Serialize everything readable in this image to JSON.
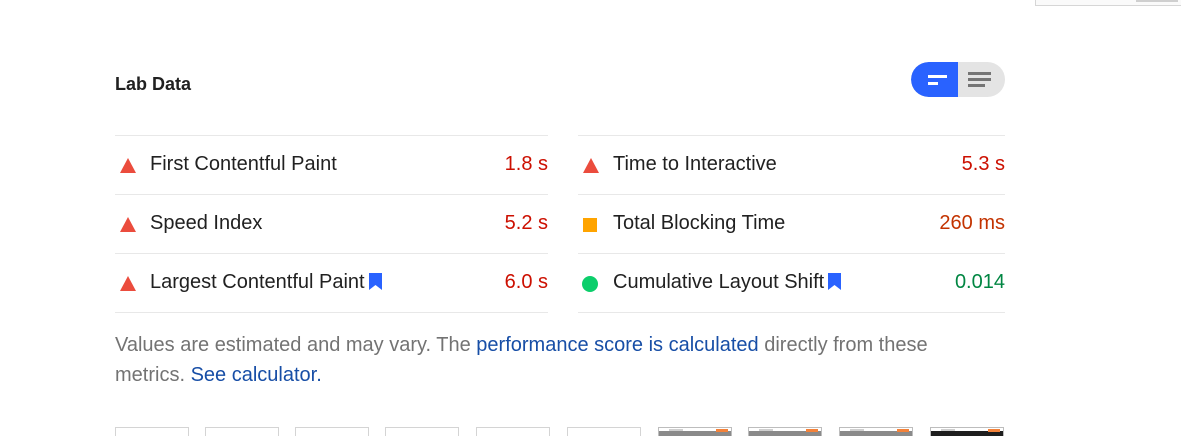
{
  "section_title": "Lab Data",
  "view_toggle": {
    "options": [
      "summary-view",
      "list-view"
    ],
    "selected": "summary-view",
    "active_color": "#2962ff"
  },
  "metrics": {
    "left": [
      {
        "label": "First Contentful Paint",
        "value": "1.8 s",
        "rating": "fail",
        "icon": "red-triangle-icon",
        "bookmark": false
      },
      {
        "label": "Speed Index",
        "value": "5.2 s",
        "rating": "fail",
        "icon": "red-triangle-icon",
        "bookmark": false
      },
      {
        "label": "Largest Contentful Paint",
        "value": "6.0 s",
        "rating": "fail",
        "icon": "red-triangle-icon",
        "bookmark": true
      }
    ],
    "right": [
      {
        "label": "Time to Interactive",
        "value": "5.3 s",
        "rating": "fail",
        "icon": "red-triangle-icon",
        "bookmark": false
      },
      {
        "label": "Total Blocking Time",
        "value": "260 ms",
        "rating": "average",
        "icon": "orange-square-icon",
        "bookmark": false
      },
      {
        "label": "Cumulative Layout Shift",
        "value": "0.014",
        "rating": "pass",
        "icon": "green-circle-icon",
        "bookmark": true
      }
    ]
  },
  "rating_colors": {
    "fail": "#cc0f00",
    "average": "#c33300",
    "pass": "#018642"
  },
  "description": {
    "text_before": "Values are estimated and may vary. The ",
    "link1": "performance score is calculated",
    "text_middle": " directly from these metrics. ",
    "link2": "See calculator."
  },
  "filmstrip": {
    "frames": [
      "blank",
      "blank",
      "blank",
      "blank",
      "blank",
      "blank",
      "loaded",
      "loaded",
      "loaded",
      "loaded-dark"
    ]
  }
}
